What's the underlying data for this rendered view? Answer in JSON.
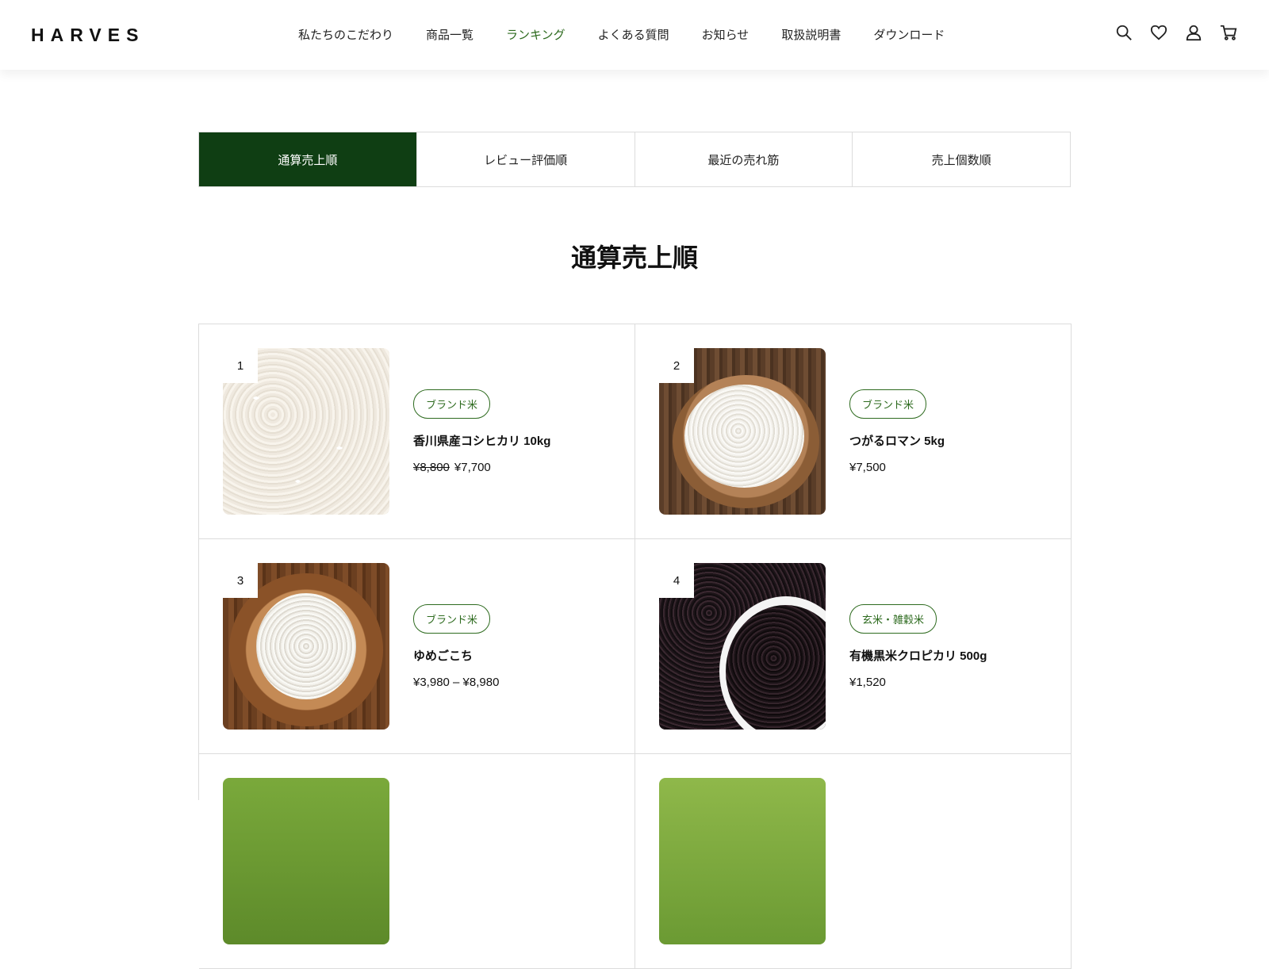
{
  "header": {
    "logo": "HARVES",
    "nav": [
      {
        "label": "私たちのこだわり",
        "active": false
      },
      {
        "label": "商品一覧",
        "active": false
      },
      {
        "label": "ランキング",
        "active": true
      },
      {
        "label": "よくある質問",
        "active": false
      },
      {
        "label": "お知らせ",
        "active": false
      },
      {
        "label": "取扱説明書",
        "active": false
      },
      {
        "label": "ダウンロード",
        "active": false
      }
    ],
    "icons": [
      "search-icon",
      "heart-icon",
      "user-icon",
      "cart-icon"
    ]
  },
  "tabs": [
    {
      "label": "通算売上順",
      "active": true
    },
    {
      "label": "レビュー評価順",
      "active": false
    },
    {
      "label": "最近の売れ筋",
      "active": false
    },
    {
      "label": "売上個数順",
      "active": false
    }
  ],
  "section_title": "通算売上順",
  "products": [
    {
      "rank": "1",
      "tag": "ブランド米",
      "name": "香川県産コシヒカリ 10kg",
      "old_price": "¥8,800",
      "price": "¥7,700"
    },
    {
      "rank": "2",
      "tag": "ブランド米",
      "name": "つがるロマン 5kg",
      "old_price": "",
      "price": "¥7,500"
    },
    {
      "rank": "3",
      "tag": "ブランド米",
      "name": "ゆめごこち",
      "old_price": "",
      "price": "¥3,980 – ¥8,980"
    },
    {
      "rank": "4",
      "tag": "玄米・雑穀米",
      "name": "有機黒米クロピカリ 500g",
      "old_price": "",
      "price": "¥1,520"
    }
  ],
  "colors": {
    "accent_green": "#0f3e13",
    "tag_green": "#2e6b1f"
  }
}
